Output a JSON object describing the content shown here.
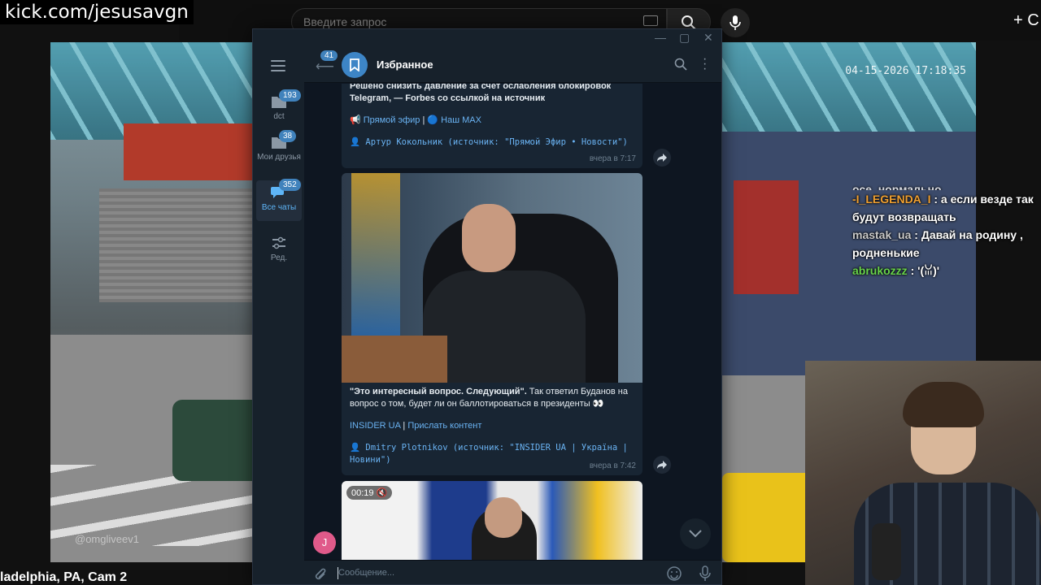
{
  "stream": {
    "url": "kick.com/jesusavgn",
    "cam_label": "ladelphia, PA, Cam 2",
    "timestamp": "04-15-2026 17:18:35",
    "watermark": "@omgliveev1"
  },
  "browser": {
    "search_placeholder": "Введите запрос",
    "create_label": "+ С"
  },
  "chat": [
    {
      "user": "",
      "text": "осе, нормально"
    },
    {
      "user": "-I_LEGENDA_I",
      "sep": " : ",
      "text": "а если везде так будут возвращать",
      "color": "#f0a030"
    },
    {
      "user": "mastak_ua",
      "sep": " : ",
      "text": "Давай на родину , родненькие",
      "color": "#c8c8c8"
    },
    {
      "user": "abrukozzz",
      "sep": " : ",
      "text": "'(ꈍ)'",
      "color": "#68d44a"
    }
  ],
  "telegram": {
    "window_controls": [
      "—",
      "▢",
      "✕"
    ],
    "sidebar": [
      {
        "label": "dct",
        "badge": "193"
      },
      {
        "label": "Мои друзья",
        "badge": "38"
      },
      {
        "label": "Все чаты",
        "badge": "352",
        "active": true
      },
      {
        "label": "Ред.",
        "badge": ""
      }
    ],
    "header": {
      "back_badge": "41",
      "title": "Избранное"
    },
    "messages": [
      {
        "text": "Решено снизить давление за счёт ослабления блокировок Telegram, — Forbes со ссылкой на источник",
        "link1": "📢 Прямой эфир",
        "link_sep": " | ",
        "link2": "🔵 Наш MAX",
        "forward": "👤 Артур Кокольник (источник: \"Прямой Эфир • Новости\")",
        "time": "вчера в 7:17"
      },
      {
        "text_bold": "\"Это интересный вопрос. Следующий\".",
        "text": " Так ответил Буданов на вопрос о том, будет ли он баллотироваться в президенты 👀",
        "link1": "INSIDER UA",
        "link_sep": " | ",
        "link2": "Прислать контент",
        "forward": "👤 Dmitry Plotnikov (источник: \"INSIDER UA | Україна | Новини\")",
        "time": "вчера в 7:42"
      },
      {
        "video_duration": "00:19 🔇"
      }
    ],
    "j_avatar": "J",
    "input_placeholder": "Сообщение..."
  }
}
